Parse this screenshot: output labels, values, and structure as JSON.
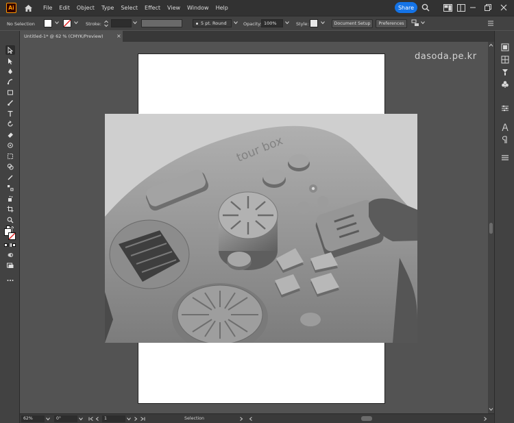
{
  "app": {
    "logo_text": "Ai",
    "accent": "#ff9a00"
  },
  "menubar": {
    "items": [
      "File",
      "Edit",
      "Object",
      "Type",
      "Select",
      "Effect",
      "View",
      "Window",
      "Help"
    ],
    "share_label": "Share",
    "share_color": "#1473e6"
  },
  "controlbar": {
    "selection_label": "No Selection",
    "stroke_label": "Stroke:",
    "brush_value": "5 pt. Round",
    "opacity_label": "Opacity:",
    "opacity_value": "100%",
    "style_label": "Style:",
    "document_setup_label": "Document Setup",
    "preferences_label": "Preferences"
  },
  "document_tab": {
    "title": "Untitled-1* @ 62 % (CMYK/Preview)",
    "close_glyph": "×"
  },
  "canvas": {
    "watermark": "dasoda.pe.kr",
    "product_logo": "tour box"
  },
  "statusbar": {
    "zoom": "62%",
    "rotation": "0°",
    "artboard_number": "1",
    "mode": "Selection"
  }
}
